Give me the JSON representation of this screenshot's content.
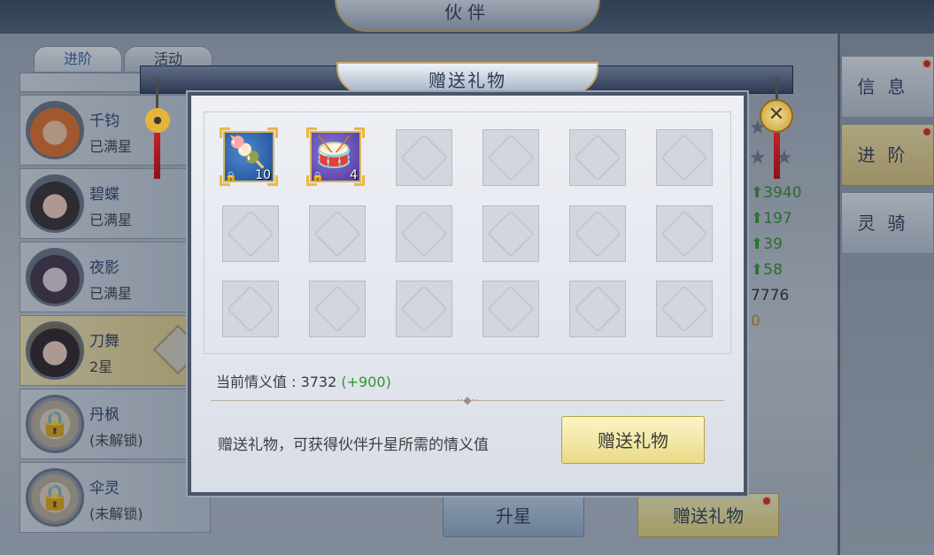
{
  "screen": {
    "title": "伙伴"
  },
  "tabs": [
    {
      "label": "进阶"
    },
    {
      "label": "活动"
    }
  ],
  "partners": [
    {
      "name": "千钧",
      "status": "已满星"
    },
    {
      "name": "碧蝶",
      "status": "已满星"
    },
    {
      "name": "夜影",
      "status": "已满星"
    },
    {
      "name": "刀舞",
      "status": "2星"
    },
    {
      "name": "丹枫",
      "status": "(未解锁)"
    },
    {
      "name": "伞灵",
      "status": "(未解锁)"
    }
  ],
  "stats": {
    "row1": "3940",
    "row2": "197",
    "row3": "39",
    "row4": "58",
    "row5": "7776",
    "row6": "0"
  },
  "side_tabs": [
    {
      "label": "信息"
    },
    {
      "label": "进阶"
    },
    {
      "label": "灵骑"
    }
  ],
  "bottom": {
    "upgrade_label": "升星",
    "gift_label": "赠送礼物"
  },
  "dialog": {
    "title": "赠送礼物",
    "items": [
      {
        "icon": "candied-haws-icon",
        "count": "10"
      },
      {
        "icon": "rattle-drum-icon",
        "count": "4"
      }
    ],
    "intimacy_label": "当前情义值 : 3732",
    "intimacy_gain": "(+900)",
    "hint": "赠送礼物，可获得伙伴升星所需的情义值",
    "button_label": "赠送礼物"
  },
  "colors": {
    "gain_green": "#2a9a2a",
    "notify_red": "#d6241e",
    "accent_gold": "#e6d57a"
  }
}
